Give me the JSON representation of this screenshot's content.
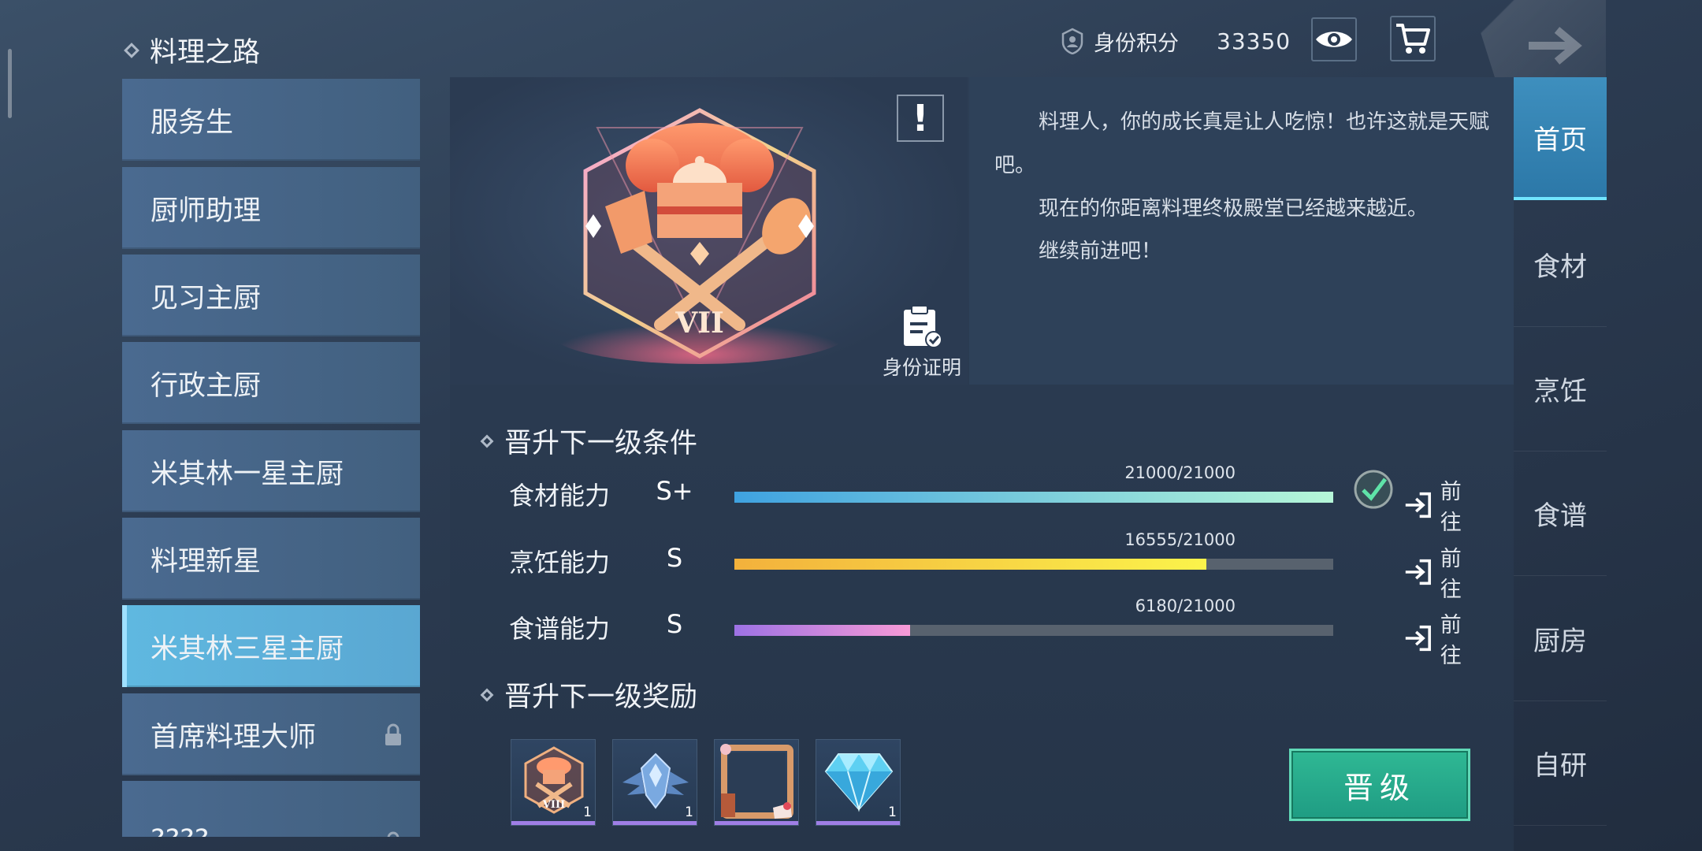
{
  "header": {
    "title": "料理之路",
    "score_label": "身份积分",
    "score_value": "33350"
  },
  "sidebar": {
    "items": [
      {
        "label": "服务生",
        "active": false,
        "locked": false
      },
      {
        "label": "厨师助理",
        "active": false,
        "locked": false
      },
      {
        "label": "见习主厨",
        "active": false,
        "locked": false
      },
      {
        "label": "行政主厨",
        "active": false,
        "locked": false
      },
      {
        "label": "米其林一星主厨",
        "active": false,
        "locked": false
      },
      {
        "label": "料理新星",
        "active": false,
        "locked": false
      },
      {
        "label": "米其林三星主厨",
        "active": true,
        "locked": false
      },
      {
        "label": "首席料理大师",
        "active": false,
        "locked": true
      },
      {
        "label": "????",
        "active": false,
        "locked": true
      }
    ]
  },
  "hero": {
    "badge_numeral": "VII",
    "id_proof_label": "身份证明",
    "description": [
      "料理人，你的成长真是让人吃惊！也许这就是天赋吧。",
      "现在的你距离料理终极殿堂已经越来越近。",
      "继续前进吧！"
    ]
  },
  "conditions": {
    "title": "晋升下一级条件",
    "rows": [
      {
        "label": "食材能力",
        "grade": "S+",
        "progress_text": "21000/21000",
        "fraction": 1.0,
        "complete": true,
        "goto": "前往",
        "bar_from": "#3fa2e0",
        "bar_to": "#b6f7d8"
      },
      {
        "label": "烹饪能力",
        "grade": "S",
        "progress_text": "16555/21000",
        "fraction": 0.788,
        "complete": false,
        "goto": "前往",
        "bar_from": "#f3b13c",
        "bar_to": "#fbf34b"
      },
      {
        "label": "食谱能力",
        "grade": "S",
        "progress_text": "6180/21000",
        "fraction": 0.294,
        "complete": false,
        "goto": "前往",
        "bar_from": "#9d72e4",
        "bar_to": "#f79ad6"
      }
    ]
  },
  "rewards": {
    "title": "晋升下一级奖励",
    "items": [
      {
        "icon": "chef-badge-icon",
        "badge_numeral": "VIII",
        "qty": "1"
      },
      {
        "icon": "winged-emblem-icon",
        "qty": "1"
      },
      {
        "icon": "avatar-frame-icon",
        "qty": ""
      },
      {
        "icon": "diamond-icon",
        "qty": "1"
      }
    ]
  },
  "promote_button": "晋级",
  "rightnav": {
    "items": [
      {
        "label": "首页",
        "active": true
      },
      {
        "label": "食材",
        "active": false
      },
      {
        "label": "烹饪",
        "active": false
      },
      {
        "label": "食谱",
        "active": false
      },
      {
        "label": "厨房",
        "active": false
      },
      {
        "label": "自研",
        "active": false
      }
    ]
  },
  "colors": {
    "accent_active": "#5fb8e0",
    "promote_green": "#2fb894",
    "reward_underline": "#9f7ee6"
  }
}
